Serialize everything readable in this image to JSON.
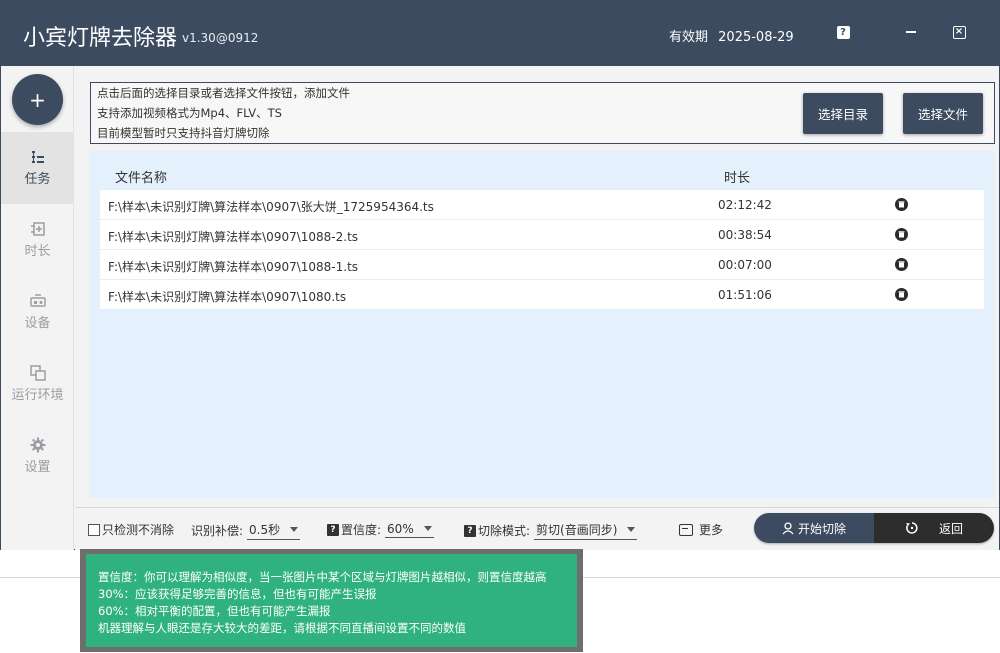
{
  "app": {
    "title": "小宾灯牌去除器",
    "version": "v1.30@0912",
    "validity_label": "有效期",
    "validity_date": "2025-08-29"
  },
  "window_controls": {
    "help": "?",
    "close": "×"
  },
  "sidebar": {
    "add_label": "+",
    "items": [
      {
        "label": "任务",
        "icon": "tasks-icon",
        "active": true
      },
      {
        "label": "时长",
        "icon": "duration-icon",
        "active": false
      },
      {
        "label": "设备",
        "icon": "device-icon",
        "active": false
      },
      {
        "label": "运行环境",
        "icon": "environment-icon",
        "active": false
      },
      {
        "label": "设置",
        "icon": "gear-icon",
        "active": false
      }
    ]
  },
  "info": {
    "lines": [
      "点击后面的选择目录或者选择文件按钮，添加文件",
      "支持添加视频格式为Mp4、FLV、TS",
      "目前模型暂时只支持抖音灯牌切除"
    ],
    "btn_dir": "选择目录",
    "btn_file": "选择文件"
  },
  "table": {
    "headers": {
      "name": "文件名称",
      "duration": "时长"
    },
    "rows": [
      {
        "name": "F:\\样本\\未识别灯牌\\算法样本\\0907\\张大饼_1725954364.ts",
        "duration": "02:12:42"
      },
      {
        "name": "F:\\样本\\未识别灯牌\\算法样本\\0907\\1088-2.ts",
        "duration": "00:38:54"
      },
      {
        "name": "F:\\样本\\未识别灯牌\\算法样本\\0907\\1088-1.ts",
        "duration": "00:07:00"
      },
      {
        "name": "F:\\样本\\未识别灯牌\\算法样本\\0907\\1080.ts",
        "duration": "01:51:06"
      }
    ]
  },
  "bottom": {
    "detect_only": "只检测不消除",
    "compensation_label": "识别补偿:",
    "compensation_value": "0.5秒",
    "confidence_label": "置信度:",
    "confidence_value": "60%",
    "cut_mode_label": "切除模式:",
    "cut_mode_value": "剪切(音画同步)",
    "more": "更多",
    "start": "开始切除",
    "back": "返回"
  },
  "tooltip": {
    "lines": [
      "置信度：你可以理解为相似度，当一张图片中某个区域与灯牌图片越相似，则置信度越高",
      "30%：应该获得足够完善的信息，但也有可能产生误报",
      "60%：相对平衡的配置，但也有可能产生漏报",
      "机器理解与人眼还是存大较大的差距，请根据不同直播间设置不同的数值"
    ]
  },
  "colors": {
    "primary": "#3c4b5f",
    "table_bg": "#e4f1fc",
    "tooltip_bg": "#2fb27d"
  }
}
